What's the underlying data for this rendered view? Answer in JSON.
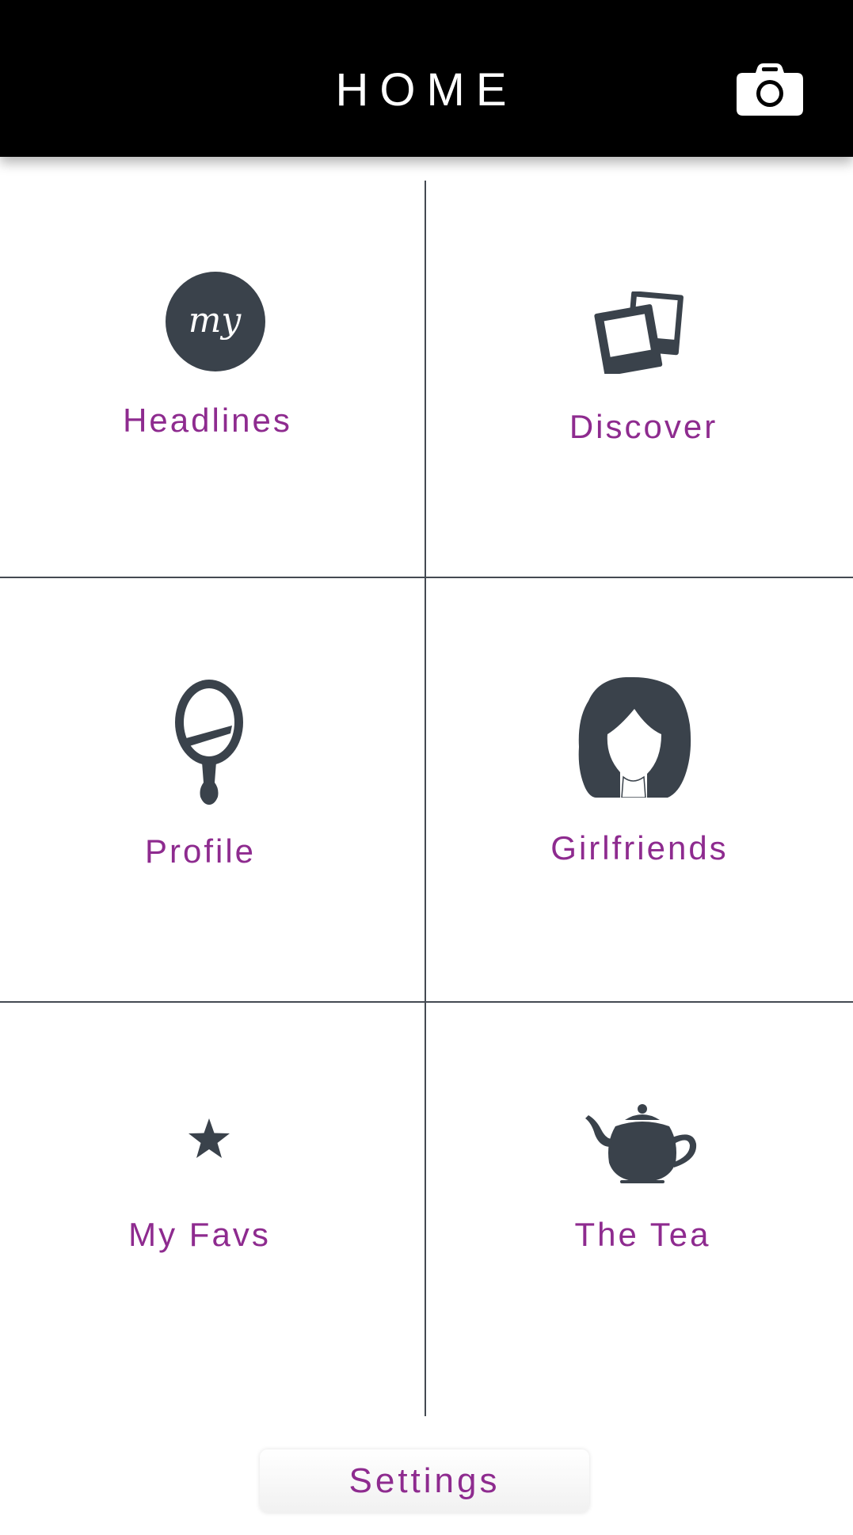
{
  "header": {
    "title": "HOME",
    "camera_icon": "camera-icon"
  },
  "tiles": [
    {
      "label": "Headlines",
      "icon": "my-circle-icon"
    },
    {
      "label": "Discover",
      "icon": "photos-icon"
    },
    {
      "label": "Profile",
      "icon": "hand-mirror-icon"
    },
    {
      "label": "Girlfriends",
      "icon": "girl-silhouette-icon"
    },
    {
      "label": "My Favs",
      "icon": "star-icon"
    },
    {
      "label": "The Tea",
      "icon": "teapot-icon"
    }
  ],
  "icon_text": {
    "my": "my"
  },
  "footer": {
    "settings_label": "Settings"
  },
  "colors": {
    "header_bg": "#000000",
    "label": "#8e2b8f",
    "icon": "#3a424b",
    "divider": "#444a52"
  }
}
